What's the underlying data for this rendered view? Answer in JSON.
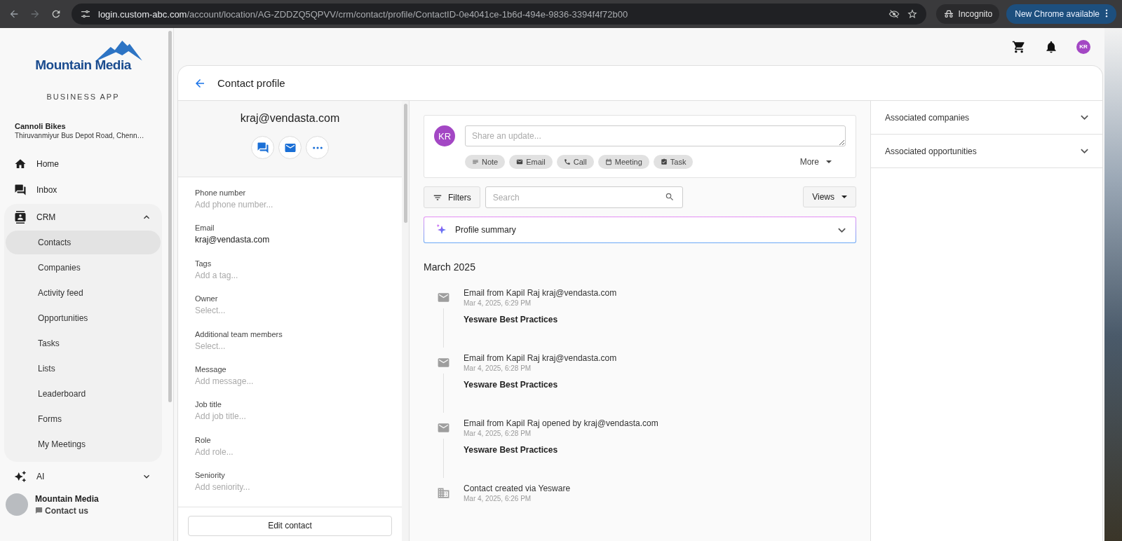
{
  "browser": {
    "url_host": "login.custom-abc.com",
    "url_path": "/account/location/AG-ZDDZQ5QPVV/crm/contact/profile/ContactID-0e4041ce-1b6d-494e-9836-3394f4f72b00",
    "incognito_label": "Incognito",
    "update_button": "New Chrome available"
  },
  "sidebar": {
    "brand": "Mountain Media",
    "tagline": "BUSINESS APP",
    "business_name": "Cannoli Bikes",
    "business_address": "Thiruvanmiyur Bus Depot Road, Chenn…",
    "items": [
      {
        "kind": "home",
        "label": "Home"
      },
      {
        "kind": "inbox",
        "label": "Inbox"
      },
      {
        "kind": "crm",
        "label": "CRM",
        "expanded": true,
        "children": [
          {
            "label": "Contacts",
            "selected": true
          },
          {
            "label": "Companies",
            "selected": false
          },
          {
            "label": "Activity feed",
            "selected": false
          },
          {
            "label": "Opportunities",
            "selected": false
          },
          {
            "label": "Tasks",
            "selected": false
          },
          {
            "label": "Lists",
            "selected": false
          },
          {
            "label": "Leaderboard",
            "selected": false
          },
          {
            "label": "Forms",
            "selected": false
          },
          {
            "label": "My Meetings",
            "selected": false
          }
        ]
      },
      {
        "kind": "ai",
        "label": "AI",
        "expanded": false
      }
    ],
    "footer": {
      "name": "Mountain Media",
      "link": "Contact us"
    }
  },
  "topbar": {
    "avatar_initials": "KR"
  },
  "page": {
    "title": "Contact profile"
  },
  "contact": {
    "heading": "kraj@vendasta.com",
    "fields": [
      {
        "label": "Phone number",
        "placeholder": "Add phone number..."
      },
      {
        "label": "Email",
        "value": "kraj@vendasta.com"
      },
      {
        "label": "Tags",
        "placeholder": "Add a tag..."
      },
      {
        "label": "Owner",
        "placeholder": "Select..."
      },
      {
        "label": "Additional team members",
        "placeholder": "Select..."
      },
      {
        "label": "Message",
        "placeholder": "Add message..."
      },
      {
        "label": "Job title",
        "placeholder": "Add job title..."
      },
      {
        "label": "Role",
        "placeholder": "Add role..."
      },
      {
        "label": "Seniority",
        "placeholder": "Add seniority..."
      }
    ],
    "edit_button": "Edit contact"
  },
  "composer": {
    "avatar_initials": "KR",
    "placeholder": "Share an update...",
    "actions": [
      {
        "kind": "note",
        "label": "Note"
      },
      {
        "kind": "email",
        "label": "Email"
      },
      {
        "kind": "call",
        "label": "Call"
      },
      {
        "kind": "meeting",
        "label": "Meeting"
      },
      {
        "kind": "task",
        "label": "Task"
      }
    ],
    "more": "More"
  },
  "filters": {
    "filters_button": "Filters",
    "search_placeholder": "Search",
    "views_button": "Views"
  },
  "profile_summary": {
    "label": "Profile summary",
    "expanded": false
  },
  "timeline": {
    "month": "March 2025",
    "entries": [
      {
        "kind": "email",
        "title": "Email from Kapil Raj kraj@vendasta.com",
        "time": "Mar 4, 2025, 6:29 PM",
        "subject": "Yesware Best Practices"
      },
      {
        "kind": "email",
        "title": "Email from Kapil Raj kraj@vendasta.com",
        "time": "Mar 4, 2025, 6:28 PM",
        "subject": "Yesware Best Practices"
      },
      {
        "kind": "email",
        "title": "Email from Kapil Raj opened by kraj@vendasta.com",
        "time": "Mar 4, 2025, 6:28 PM",
        "subject": "Yesware Best Practices"
      },
      {
        "kind": "created",
        "title": "Contact created via Yesware",
        "time": "Mar 4, 2025, 6:26 PM"
      }
    ]
  },
  "associations": [
    {
      "label": "Associated companies",
      "expanded": false
    },
    {
      "label": "Associated opportunities",
      "expanded": false
    }
  ]
}
